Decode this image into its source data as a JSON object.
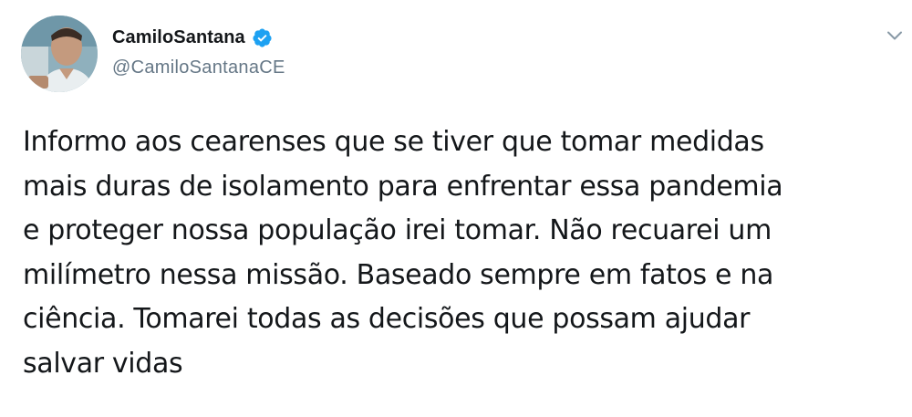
{
  "tweet": {
    "author": {
      "display_name": "CamiloSantana",
      "handle": "@CamiloSantanaCE",
      "verified": true,
      "avatar_icon": "profile-photo"
    },
    "menu_icon": "chevron-down-icon",
    "text_lines": [
      "Informo aos cearenses que se tiver que tomar medidas",
      "mais duras de isolamento para enfrentar essa pandemia",
      "e proteger nossa população irei tomar. Não recuarei um",
      "milímetro nessa missão. Baseado sempre em fatos e na",
      "ciência. Tomarei todas as decisões que possam ajudar",
      "salvar vidas"
    ]
  },
  "colors": {
    "text_primary": "#14171a",
    "text_secondary": "#657786",
    "verified_badge": "#1da1f2",
    "caret": "#8899a6"
  }
}
